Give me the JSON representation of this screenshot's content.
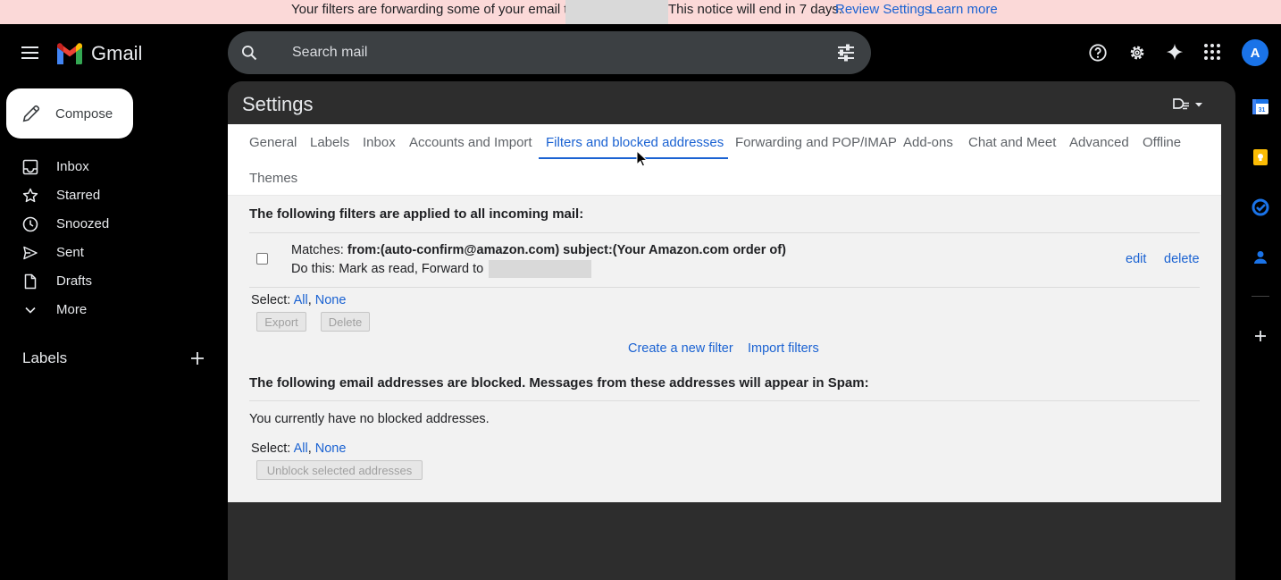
{
  "banner": {
    "text": "Your filters are forwarding some of your email to",
    "notice": "This notice will end in 7 days.",
    "review_link": "Review Settings",
    "learn_link": "Learn more"
  },
  "header": {
    "app_name": "Gmail",
    "search_placeholder": "Search mail",
    "avatar_letter": "A"
  },
  "sidebar": {
    "compose_label": "Compose",
    "items": [
      {
        "label": "Inbox",
        "icon": "inbox-icon"
      },
      {
        "label": "Starred",
        "icon": "star-icon"
      },
      {
        "label": "Snoozed",
        "icon": "clock-icon"
      },
      {
        "label": "Sent",
        "icon": "send-icon"
      },
      {
        "label": "Drafts",
        "icon": "draft-icon"
      },
      {
        "label": "More",
        "icon": "chevron-down-icon"
      }
    ],
    "labels_heading": "Labels"
  },
  "settings": {
    "title": "Settings",
    "tabs": [
      {
        "label": "General"
      },
      {
        "label": "Labels"
      },
      {
        "label": "Inbox"
      },
      {
        "label": "Accounts and Import"
      },
      {
        "label": "Filters and blocked addresses"
      },
      {
        "label": "Forwarding and POP/IMAP"
      },
      {
        "label": "Add-ons"
      },
      {
        "label": "Chat and Meet"
      },
      {
        "label": "Advanced"
      },
      {
        "label": "Offline"
      },
      {
        "label": "Themes"
      }
    ],
    "active_tab": "Filters and blocked addresses"
  },
  "filters": {
    "heading": "The following filters are applied to all incoming mail:",
    "filter": {
      "matches_label": "Matches:",
      "matches_value": "from:(auto-confirm@amazon.com) subject:(Your Amazon.com order of)",
      "action_label": "Do this:",
      "action_value": "Mark as read, Forward to",
      "edit": "edit",
      "delete": "delete"
    },
    "select_label": "Select:",
    "select_all": "All",
    "select_none": "None",
    "export_button": "Export",
    "delete_button": "Delete",
    "create_link": "Create a new filter",
    "import_link": "Import filters"
  },
  "blocked": {
    "heading": "The following email addresses are blocked. Messages from these addresses will appear in Spam:",
    "empty_text": "You currently have no blocked addresses.",
    "select_label": "Select:",
    "select_all": "All",
    "select_none": "None",
    "unblock_button": "Unblock selected addresses"
  },
  "colors": {
    "accent": "#1a62d2",
    "banner_bg": "#fbd9d8",
    "panel_bg": "#f2f2f2",
    "avatar_bg": "#1a73e8"
  }
}
